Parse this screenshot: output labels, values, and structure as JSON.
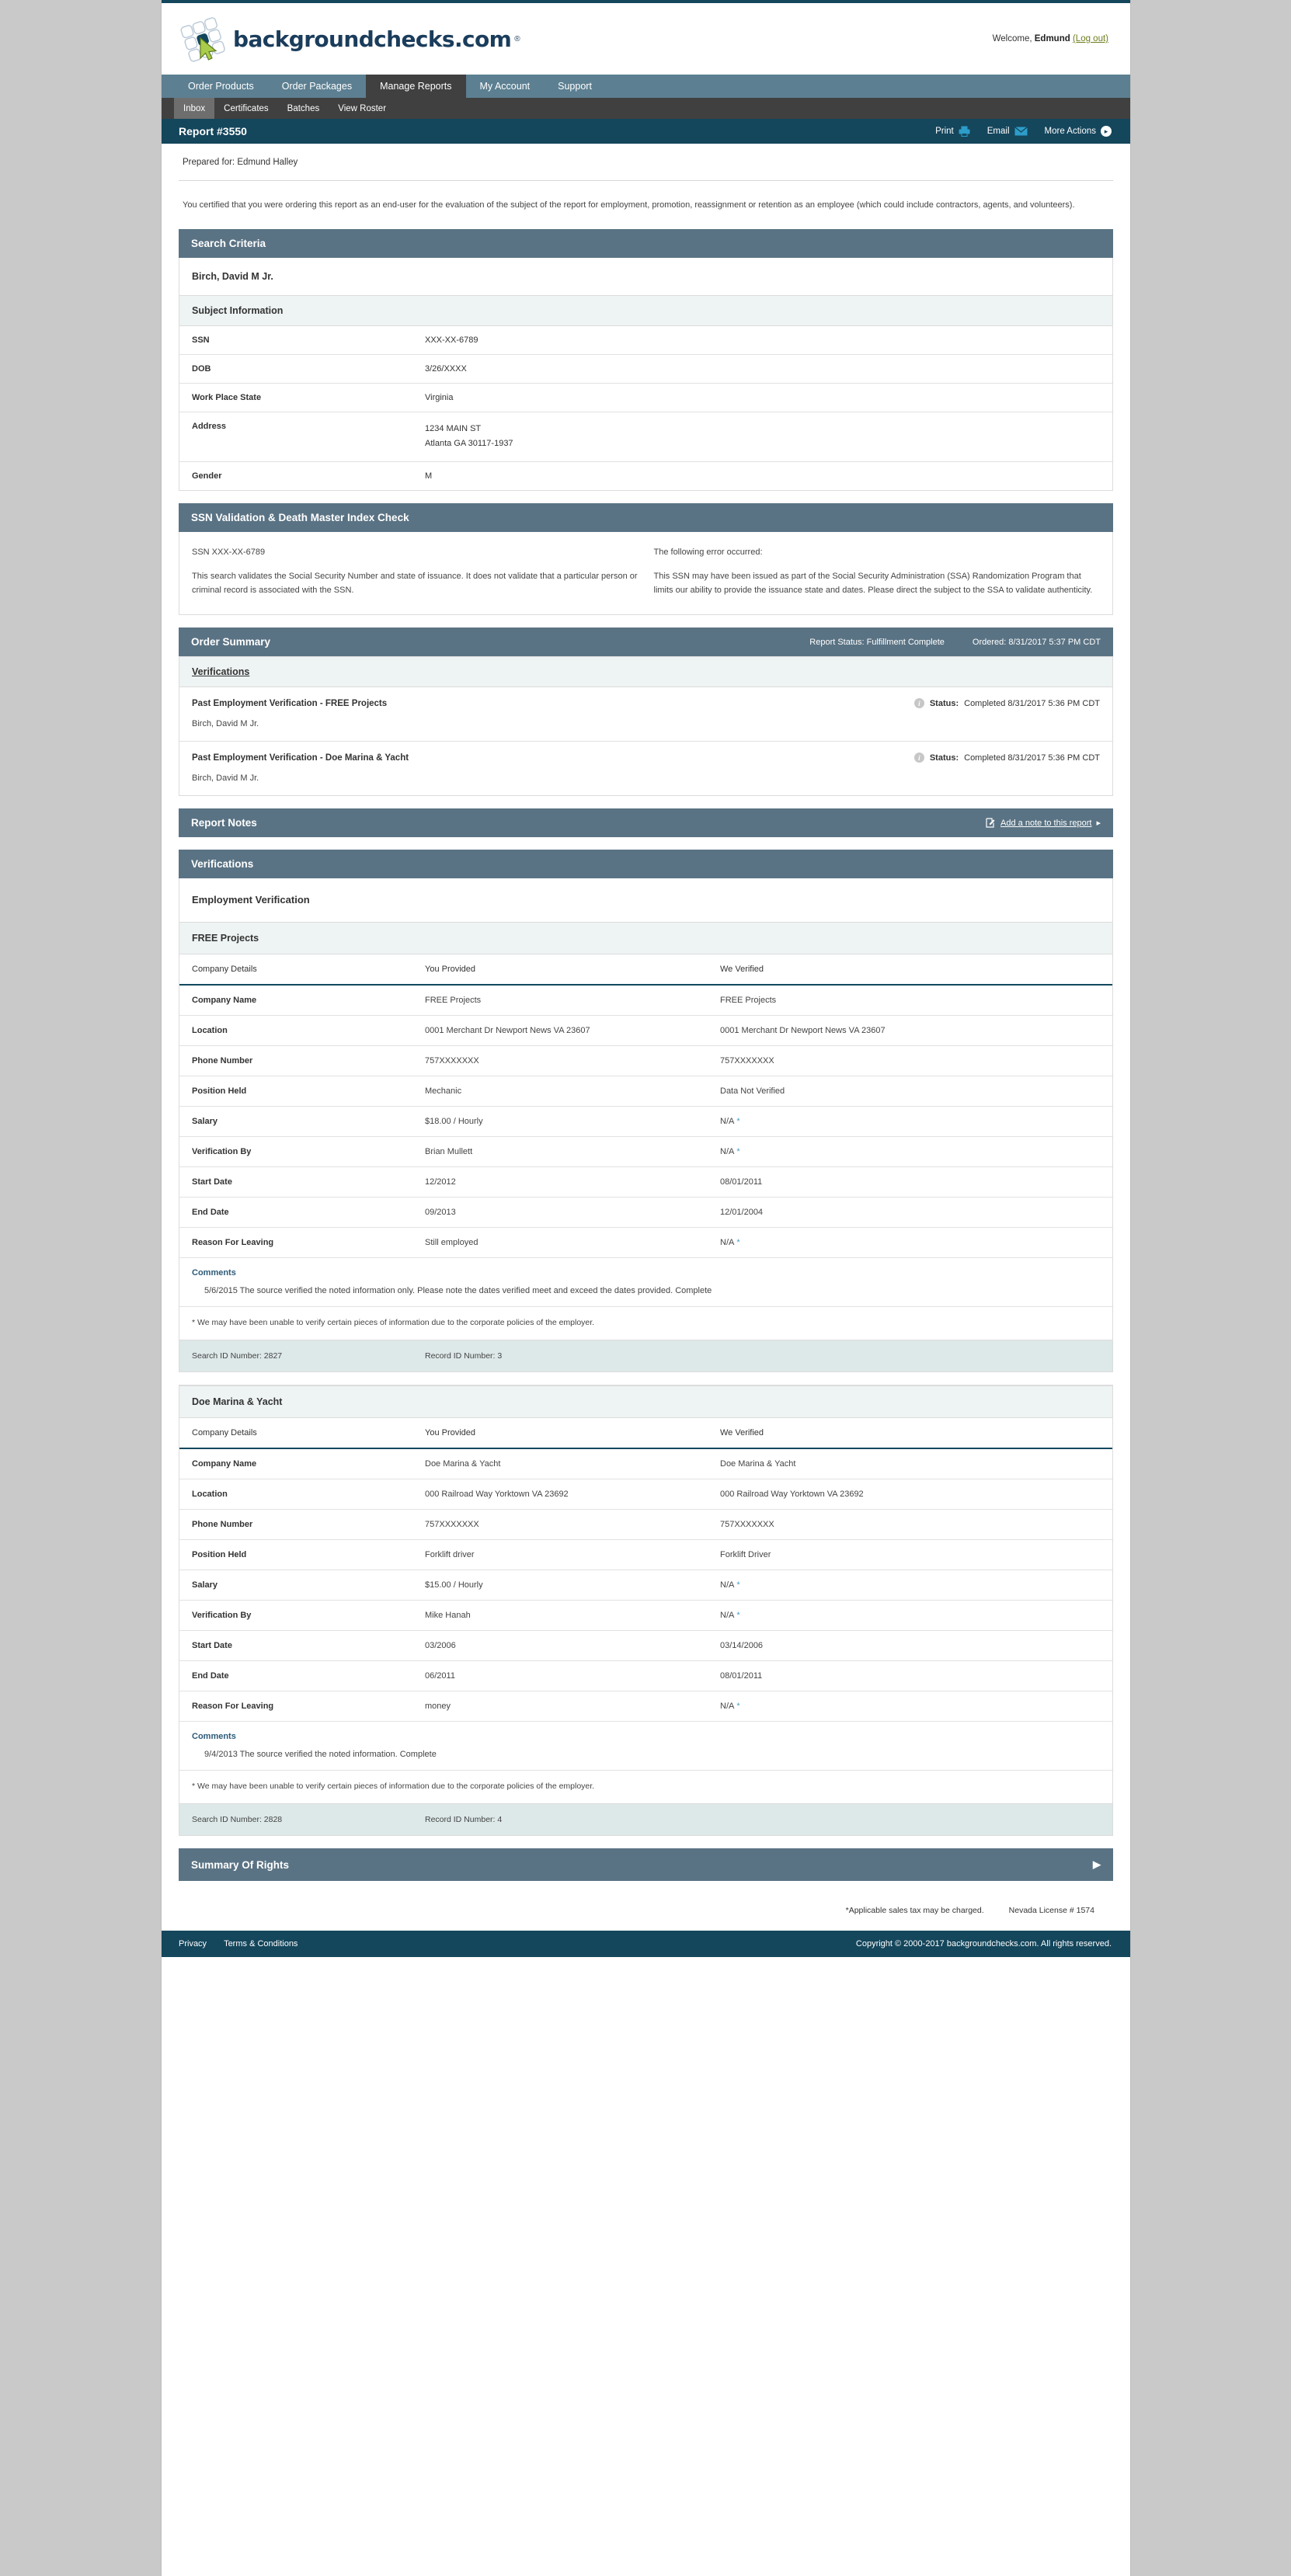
{
  "brand": {
    "logo_text": "backgroundchecks.com",
    "registered_mark": "®",
    "welcome_prefix": "Welcome,",
    "welcome_user": "Edmund",
    "logout_label": "(Log out)"
  },
  "mainnav": [
    {
      "label": "Order Products",
      "active": false
    },
    {
      "label": "Order Packages",
      "active": false
    },
    {
      "label": "Manage Reports",
      "active": true
    },
    {
      "label": "My Account",
      "active": false
    },
    {
      "label": "Support",
      "active": false
    }
  ],
  "subnav": [
    {
      "label": "Inbox",
      "active": true
    },
    {
      "label": "Certificates",
      "active": false
    },
    {
      "label": "Batches",
      "active": false
    },
    {
      "label": "View Roster",
      "active": false
    }
  ],
  "report_bar": {
    "title": "Report #3550",
    "print_label": "Print",
    "email_label": "Email",
    "more_actions_label": "More Actions"
  },
  "prepared_for": "Prepared for: Edmund Halley",
  "certification_text": "You certified that you were ordering this report as an end-user for the evaluation of the subject of the report for employment, promotion, reassignment or retention as an employee (which could include contractors, agents, and volunteers).",
  "search_criteria": {
    "heading": "Search Criteria",
    "subject_name": "Birch, David M Jr.",
    "subject_info_heading": "Subject Information",
    "rows": [
      {
        "key": "SSN",
        "value": "XXX-XX-6789"
      },
      {
        "key": "DOB",
        "value": "3/26/XXXX"
      },
      {
        "key": "Work Place State",
        "value": "Virginia"
      },
      {
        "key": "Address",
        "value": "1234 MAIN ST\nAtlanta GA 30117-1937"
      },
      {
        "key": "Gender",
        "value": "M"
      }
    ]
  },
  "ssn_check": {
    "heading": "SSN Validation & Death Master Index Check",
    "ssn_line": "SSN  XXX-XX-6789",
    "description": "This search validates the Social Security Number and state of issuance. It does not validate that a particular person or criminal record is associated with the SSN.",
    "error_title": "The following error occurred:",
    "error_body": "This SSN may have been issued as part of the Social Security Administration (SSA) Randomization Program that limits our ability to provide the issuance state and dates. Please direct the subject to the SSA to validate authenticity."
  },
  "order_summary": {
    "heading": "Order Summary",
    "report_status": "Report Status: Fulfillment Complete",
    "ordered": "Ordered: 8/31/2017 5:37 PM CDT",
    "subheading": "Verifications",
    "items": [
      {
        "name": "Past Employment Verification - FREE Projects",
        "status_label": "Status:",
        "status_value": "Completed 8/31/2017 5:36 PM CDT",
        "subject": "Birch, David M Jr."
      },
      {
        "name": "Past Employment Verification - Doe Marina & Yacht",
        "status_label": "Status:",
        "status_value": "Completed 8/31/2017 5:36 PM CDT",
        "subject": "Birch, David M Jr."
      }
    ]
  },
  "report_notes": {
    "heading": "Report Notes",
    "add_note_label": "Add a note to this report"
  },
  "verifications_section": {
    "heading": "Verifications",
    "employment_title": "Employment Verification",
    "columns": [
      "Company Details",
      "You Provided",
      "We Verified"
    ],
    "footnote": "* We may have been unable to verify certain pieces of information due to the corporate policies of the employer.",
    "comments_title": "Comments",
    "companies": [
      {
        "name": "FREE Projects",
        "rows": [
          {
            "key": "Company Name",
            "provided": "FREE Projects",
            "verified": "FREE Projects",
            "verified_ast": false
          },
          {
            "key": "Location",
            "provided": "0001 Merchant Dr Newport News VA 23607",
            "verified": "0001 Merchant Dr Newport News VA 23607",
            "verified_ast": false
          },
          {
            "key": "Phone Number",
            "provided": "757XXXXXXX",
            "verified": "757XXXXXXX",
            "verified_ast": false
          },
          {
            "key": "Position Held",
            "provided": "Mechanic",
            "verified": "Data Not Verified",
            "verified_ast": false
          },
          {
            "key": "Salary",
            "provided": "$18.00 / Hourly",
            "verified": "N/A",
            "verified_ast": true
          },
          {
            "key": "Verification By",
            "provided": "Brian Mullett",
            "verified": "N/A",
            "verified_ast": true
          },
          {
            "key": "Start Date",
            "provided": "12/2012",
            "verified": "08/01/2011",
            "verified_ast": false
          },
          {
            "key": "End Date",
            "provided": "09/2013",
            "verified": "12/01/2004",
            "verified_ast": false
          },
          {
            "key": "Reason For Leaving",
            "provided": "Still employed",
            "verified": "N/A",
            "verified_ast": true
          }
        ],
        "comment": "5/6/2015 The source verified the noted information only. Please note the dates verified meet and exceed the dates provided. Complete",
        "search_id": "Search ID Number: 2827",
        "record_id": "Record ID Number: 3"
      },
      {
        "name": "Doe Marina & Yacht",
        "rows": [
          {
            "key": "Company Name",
            "provided": "Doe Marina & Yacht",
            "verified": "Doe Marina & Yacht",
            "verified_ast": false
          },
          {
            "key": "Location",
            "provided": "000 Railroad Way Yorktown VA 23692",
            "verified": "000 Railroad Way Yorktown VA 23692",
            "verified_ast": false
          },
          {
            "key": "Phone Number",
            "provided": "757XXXXXXX",
            "verified": "757XXXXXXX",
            "verified_ast": false
          },
          {
            "key": "Position Held",
            "provided": "Forklift driver",
            "verified": "Forklift Driver",
            "verified_ast": false
          },
          {
            "key": "Salary",
            "provided": "$15.00 / Hourly",
            "verified": "N/A",
            "verified_ast": true
          },
          {
            "key": "Verification By",
            "provided": "Mike Hanah",
            "verified": "N/A",
            "verified_ast": true
          },
          {
            "key": "Start Date",
            "provided": "03/2006",
            "verified": "03/14/2006",
            "verified_ast": false
          },
          {
            "key": "End Date",
            "provided": "06/2011",
            "verified": "08/01/2011",
            "verified_ast": false
          },
          {
            "key": "Reason For Leaving",
            "provided": "money",
            "verified": "N/A",
            "verified_ast": true
          }
        ],
        "comment": "9/4/2013 The source verified the noted information. Complete",
        "search_id": "Search ID Number: 2828",
        "record_id": "Record ID Number: 4"
      }
    ]
  },
  "summary_of_rights": {
    "heading": "Summary Of Rights"
  },
  "page_note": {
    "tax": "*Applicable sales tax may be charged.",
    "license": "Nevada License # 1574"
  },
  "footer": {
    "privacy": "Privacy",
    "terms": "Terms & Conditions",
    "copyright": "Copyright © 2000-2017 backgroundchecks.com. All rights reserved."
  },
  "colors": {
    "dark_navy": "#14465c",
    "section_header": "#5a7384",
    "nav_blue": "#5c7f91",
    "subnav_dark": "#404040",
    "icon_blue": "#2d9dc9",
    "link_green": "#6f7d1c",
    "asterisk_blue": "#4b9ec4"
  }
}
